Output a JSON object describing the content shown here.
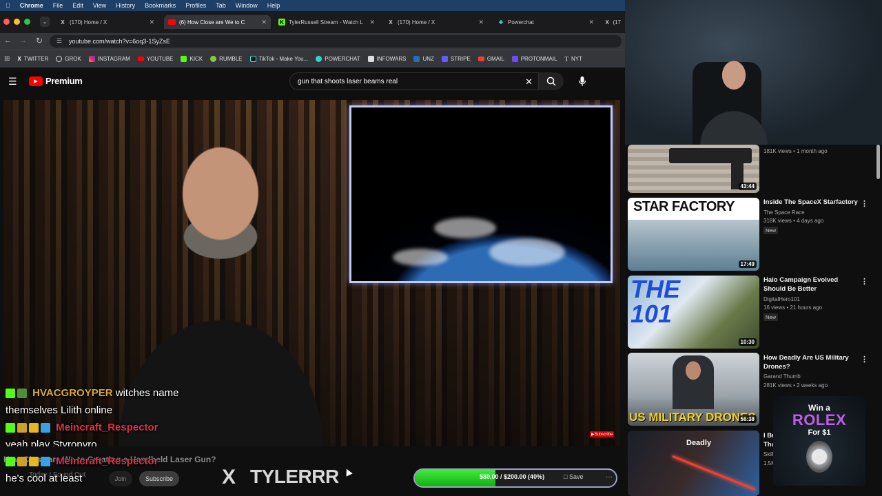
{
  "menubar": {
    "app": "Chrome",
    "items": [
      "File",
      "Edit",
      "View",
      "History",
      "Bookmarks",
      "Profiles",
      "Tab",
      "Window",
      "Help"
    ]
  },
  "tabs": [
    {
      "label": "(170) Home / X",
      "icon": "x-logo-icon"
    },
    {
      "label": "(6) How Close are We to C",
      "icon": "youtube-icon",
      "active": true
    },
    {
      "label": "TylerRussell Stream - Watch L",
      "icon": "kick-icon"
    },
    {
      "label": "(170) Home / X",
      "icon": "x-logo-icon"
    },
    {
      "label": "Powerchat",
      "icon": "powerchat-icon"
    },
    {
      "label": "(17",
      "icon": "x-logo-icon"
    }
  ],
  "address": {
    "url": "youtube.com/watch?v=6oq3-1SyZsE"
  },
  "bookmarks": [
    "TWITTER",
    "GROK",
    "INSTAGRAM",
    "YOUTUBE",
    "KICK",
    "RUMBLE",
    "TikTok - Make You...",
    "POWERCHAT",
    "INFOWARS",
    "UNZ",
    "STRIPE",
    "GMAIL",
    "PROTONMAIL",
    "NYT"
  ],
  "youtube": {
    "brand": "Premium",
    "search_value": "gun that shoots laser beams real"
  },
  "chat": [
    {
      "user": "HVACGROYPER",
      "message": "witches name"
    },
    {
      "continuation": "themselves Lilith online"
    },
    {
      "user": "Meincraft_Respector",
      "message": ""
    },
    {
      "continuation": "yeah play Styropyro"
    },
    {
      "user": "Meincraft_Respector",
      "message": ""
    },
    {
      "continuation": "he's cool at least"
    }
  ],
  "video": {
    "title": "How Close are We to Creating a Handheld Laser Gun?",
    "channel": "Today I Found Out",
    "join_label": "Join",
    "subscribe_label": "Subscribe",
    "save_label": "Save",
    "more_label": "···"
  },
  "overlay": {
    "x_logo": "X",
    "handle": "TYLERRR",
    "goal_text": "$80.00 / $200.00 (40%)",
    "goal_progress": 0.4
  },
  "sidebar": [
    {
      "title": "",
      "channel": "",
      "meta": "181K views • 1 month ago",
      "duration": "43:44",
      "badge": ""
    },
    {
      "title": "Inside The SpaceX Starfactory",
      "channel": "The Space Race",
      "meta": "318K views • 4 days ago",
      "duration": "17:49",
      "badge": "New",
      "thumb_text": "STAR FACTORY"
    },
    {
      "title": "Halo Campaign Evolved Should Be Better",
      "channel": "DigitalHero101",
      "meta": "16 views • 21 hours ago",
      "duration": "10:30",
      "badge": "New",
      "thumb_text": "THE 101"
    },
    {
      "title": "How Deadly Are US Military Drones?",
      "channel": "Garand Thumb",
      "meta": "281K views • 2 weeks ago",
      "duration": "56:38",
      "badge": "",
      "thumb_text": "US MILITARY DRONES"
    },
    {
      "title": "I Bu",
      "title2": "Tha",
      "channel": "Skill",
      "meta": "1.5M",
      "thumb_text": "Deadly"
    }
  ],
  "ad": {
    "line1": "Win a",
    "line2": "ROLEX",
    "line3": "For $1"
  },
  "colors": {
    "kick_green": "#53fc18",
    "youtube_red": "#ff0000",
    "goal_green": "#22cc22"
  }
}
